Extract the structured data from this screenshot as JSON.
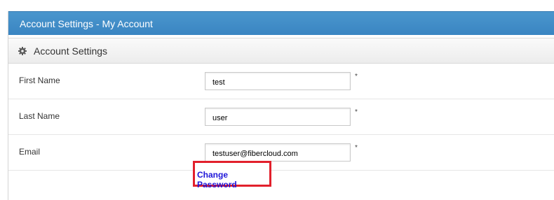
{
  "header": {
    "title": "Account Settings - My Account"
  },
  "section": {
    "title": "Account Settings",
    "icon": "gear-icon"
  },
  "fields": [
    {
      "label": "First Name",
      "value": "test",
      "required_mark": "*"
    },
    {
      "label": "Last Name",
      "value": "user",
      "required_mark": "*"
    },
    {
      "label": "Email",
      "value": "testuser@fibercloud.com",
      "required_mark": "*"
    }
  ],
  "actions": {
    "change_password_label": "Change Password"
  },
  "colors": {
    "header_bg": "#3f8dc8",
    "link": "#1e16d9",
    "highlight_border": "#e2202c"
  }
}
